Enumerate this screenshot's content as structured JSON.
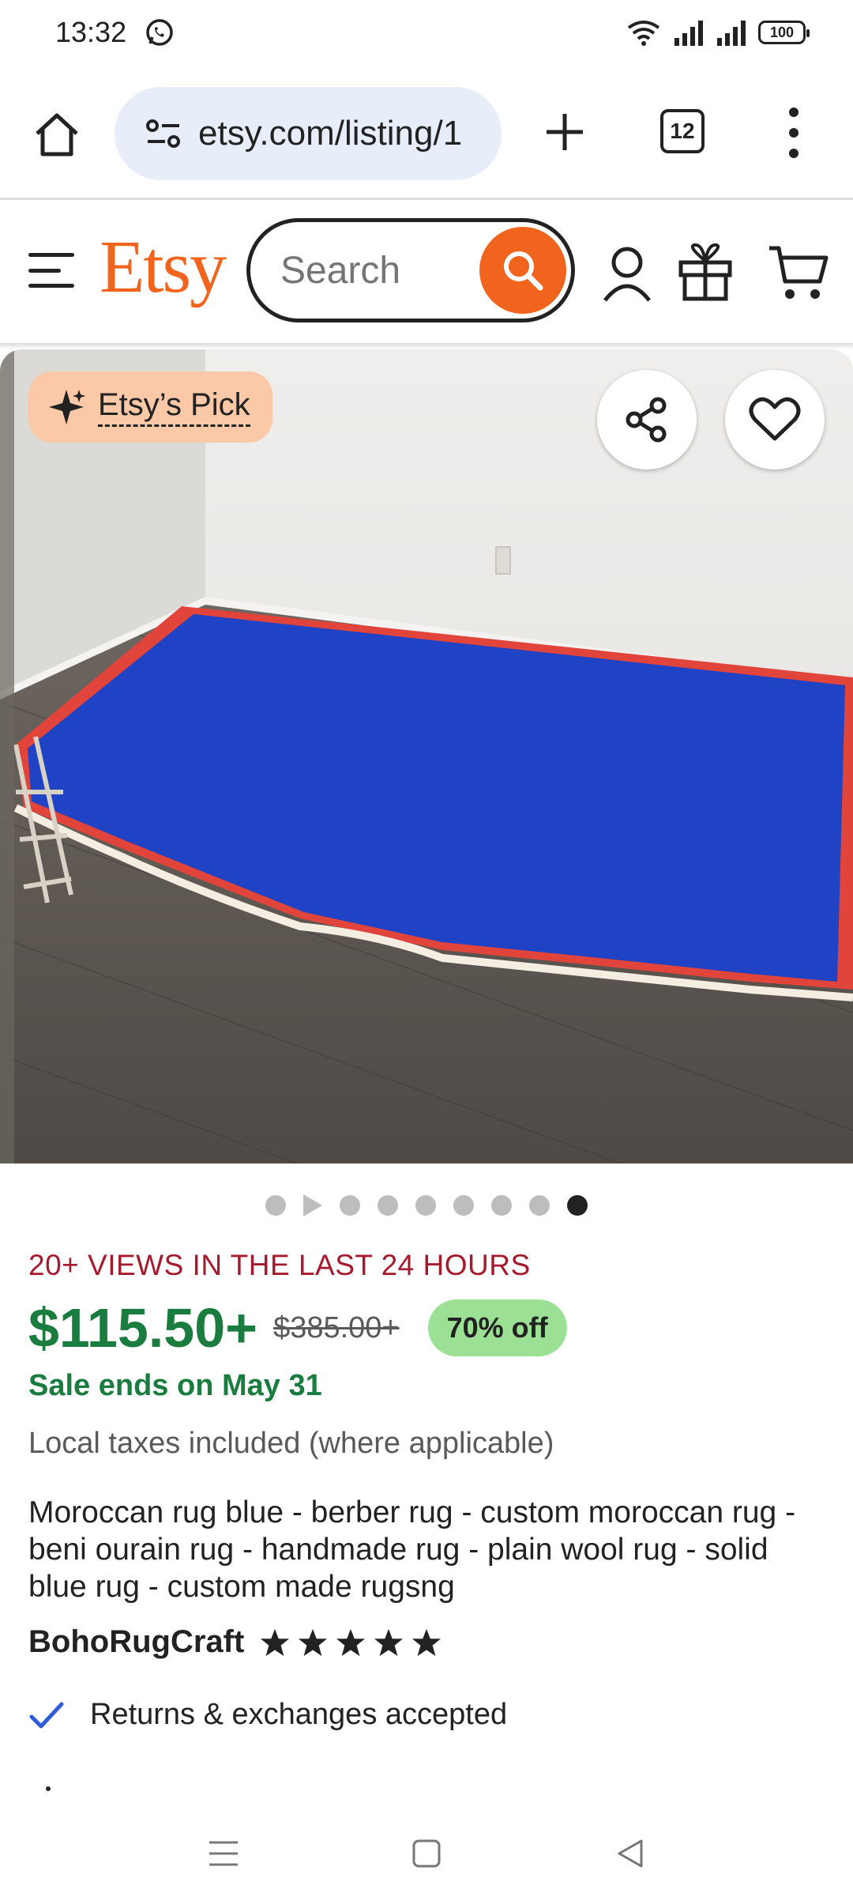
{
  "status_bar": {
    "time": "13:32",
    "battery": "100"
  },
  "browser": {
    "url": "etsy.com/listing/1",
    "tab_count": "12"
  },
  "header": {
    "logo": "Etsy",
    "search_placeholder": "Search"
  },
  "listing": {
    "badge": "Etsy’s Pick",
    "image_count": 9,
    "active_image_index": 8,
    "views": "20+ VIEWS IN THE LAST 24 HOURS",
    "price": "$115.50+",
    "original_price": "$385.00+",
    "discount": "70% off",
    "sale_ends": "Sale ends on May 31",
    "taxes": "Local taxes included (where applicable)",
    "title": "Moroccan rug blue - berber rug - custom moroccan rug - beni ourain rug - handmade rug - plain wool rug - solid blue rug - custom made rugsng",
    "shop_name": "BohoRugCraft",
    "rating_stars": 5,
    "returns": "Returns & exchanges accepted"
  },
  "colors": {
    "brand": "#f1641e",
    "price_green": "#1a7c3e",
    "views_red": "#a61a2e",
    "badge_bg": "#fbc9a8",
    "discount_bg": "#9ce095",
    "rug_blue": "#1e3fbf",
    "rug_border": "#e0443a"
  }
}
